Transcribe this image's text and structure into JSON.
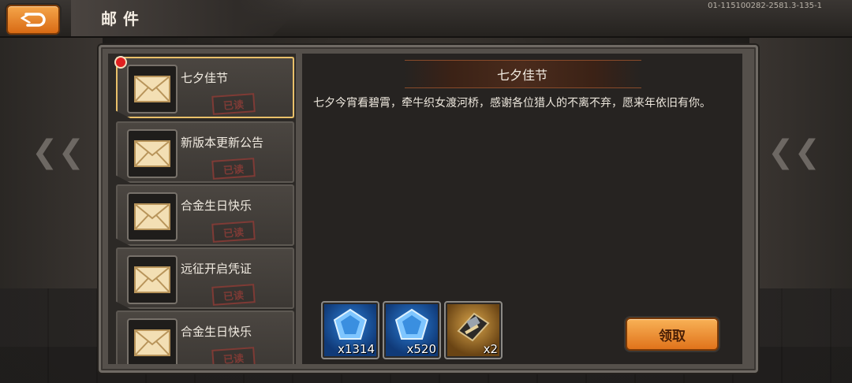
{
  "header": {
    "title": "邮件",
    "version": "01-115100282-2581.3-135-1"
  },
  "mail_list": [
    {
      "subject": "七夕佳节",
      "status": "已读",
      "selected": true,
      "unread_dot": true
    },
    {
      "subject": "新版本更新公告",
      "status": "已读"
    },
    {
      "subject": "合金生日快乐",
      "status": "已读"
    },
    {
      "subject": "远征开启凭证",
      "status": "已读"
    },
    {
      "subject": "合金生日快乐",
      "status": "已读"
    }
  ],
  "content": {
    "title": "七夕佳节",
    "body": "七夕今宵看碧霄，牵牛织女渡河桥，感谢各位猎人的不离不弃，愿来年依旧有你。"
  },
  "rewards": [
    {
      "item": "blue-gem-icon",
      "quantity": "x1314"
    },
    {
      "item": "blue-gem-icon",
      "quantity": "x520"
    },
    {
      "item": "gear-chest-icon",
      "quantity": "x2"
    }
  ],
  "claim_button": "领取",
  "colors": {
    "accent_orange": "#e0731b",
    "selected_border": "#e9c06a",
    "stamp_red": "#8a3b36"
  }
}
